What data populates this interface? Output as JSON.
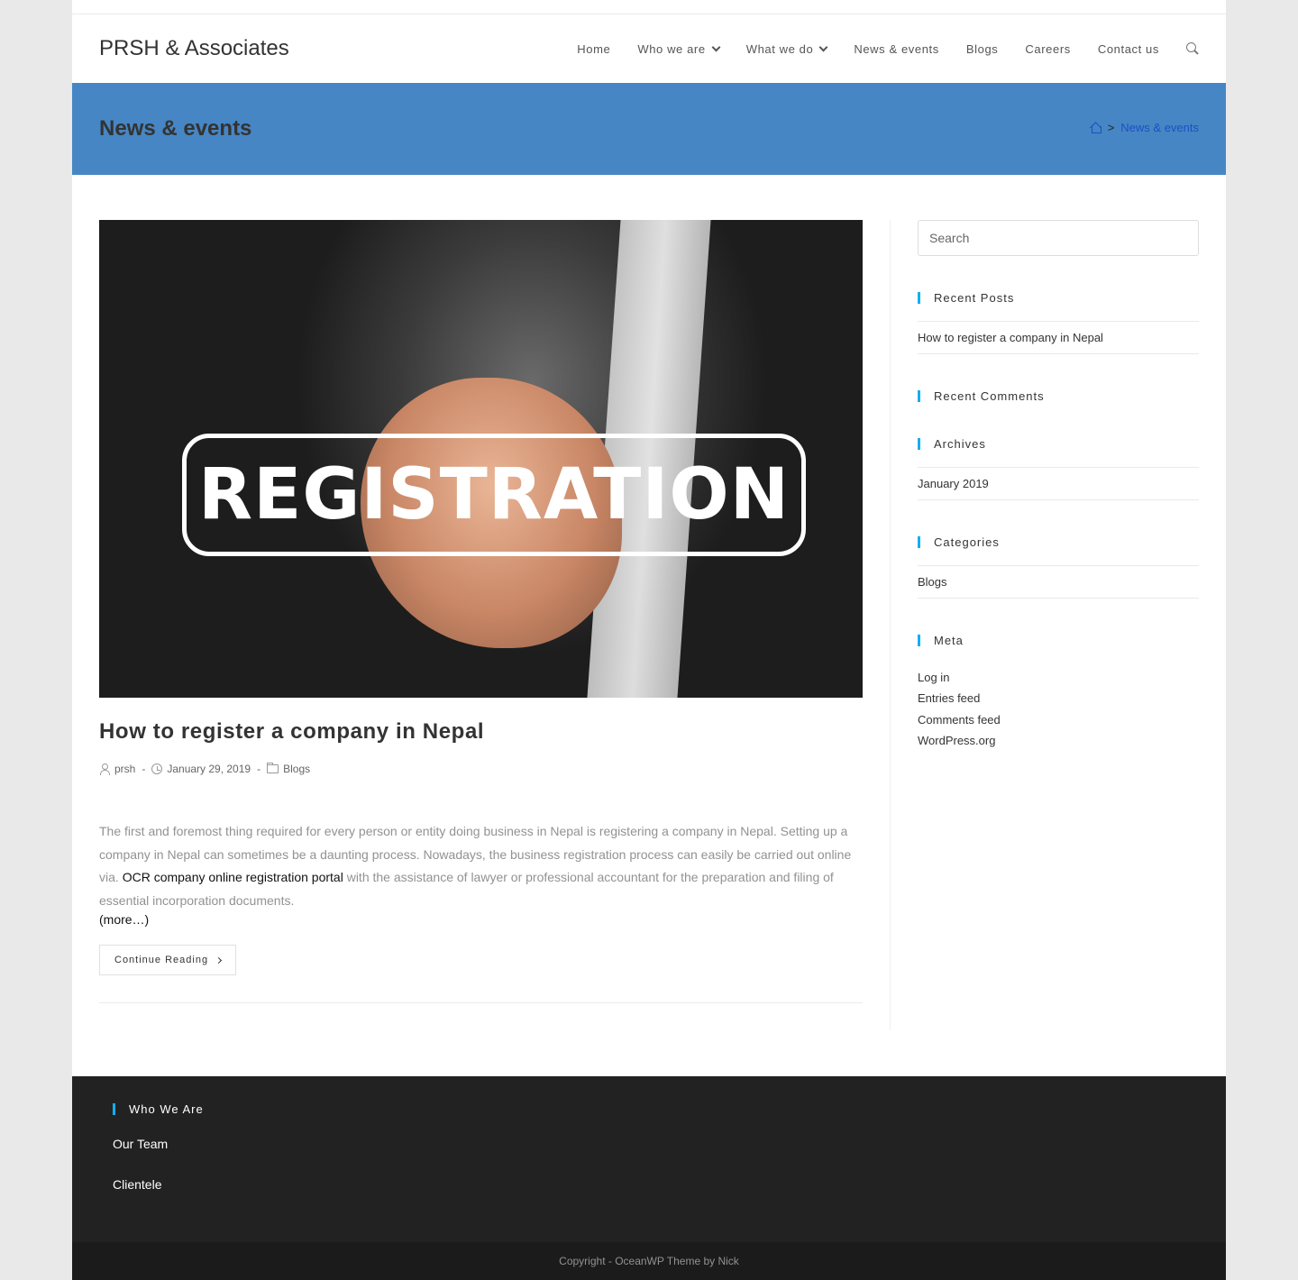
{
  "site": {
    "logo": "PRSH & Associates"
  },
  "nav": {
    "items": [
      {
        "label": "Home"
      },
      {
        "label": "Who we are"
      },
      {
        "label": "What we do"
      },
      {
        "label": "News & events"
      },
      {
        "label": "Blogs"
      },
      {
        "label": "Careers"
      },
      {
        "label": "Contact us"
      }
    ]
  },
  "page_header": {
    "title": "News & events",
    "breadcrumb": {
      "separator": ">",
      "current": "News & events"
    }
  },
  "post": {
    "image_text": "REGISTRATION",
    "title": "How to register a company in Nepal",
    "author": "prsh",
    "date": "January 29, 2019",
    "category": "Blogs",
    "meta_sep": "-",
    "excerpt_before": "The first and foremost thing required for every person or entity doing business in Nepal is registering a company in Nepal. Setting up a company in Nepal can sometimes be a daunting process. Nowadays, the business registration process can easily be carried out online via. ",
    "excerpt_link": "OCR company online registration portal",
    "excerpt_after": " with the assistance of lawyer or professional accountant for the preparation and filing of essential incorporation documents.",
    "more": "(more…)",
    "continue_label": "Continue Reading"
  },
  "sidebar": {
    "search_placeholder": "Search",
    "recent_posts_title": "Recent Posts",
    "recent_posts": [
      "How to register a company in Nepal"
    ],
    "recent_comments_title": "Recent Comments",
    "archives_title": "Archives",
    "archives": [
      "January 2019"
    ],
    "categories_title": "Categories",
    "categories": [
      "Blogs"
    ],
    "meta_title": "Meta",
    "meta_links": [
      "Log in",
      "Entries feed",
      "Comments feed",
      "WordPress.org"
    ]
  },
  "footer": {
    "widget_title": "Who We Are",
    "links": [
      "Our Team",
      "Clientele"
    ],
    "copyright": "Copyright - OceanWP Theme by Nick"
  },
  "colors": {
    "header_band": "#4686c4",
    "accent": "#13aff0",
    "breadcrumb_link": "#1e4fc4",
    "footer_bg": "#222222"
  },
  "icons": [
    "chevron-down-icon",
    "search-icon",
    "home-icon",
    "user-icon",
    "clock-icon",
    "folder-icon",
    "chevron-right-icon"
  ]
}
